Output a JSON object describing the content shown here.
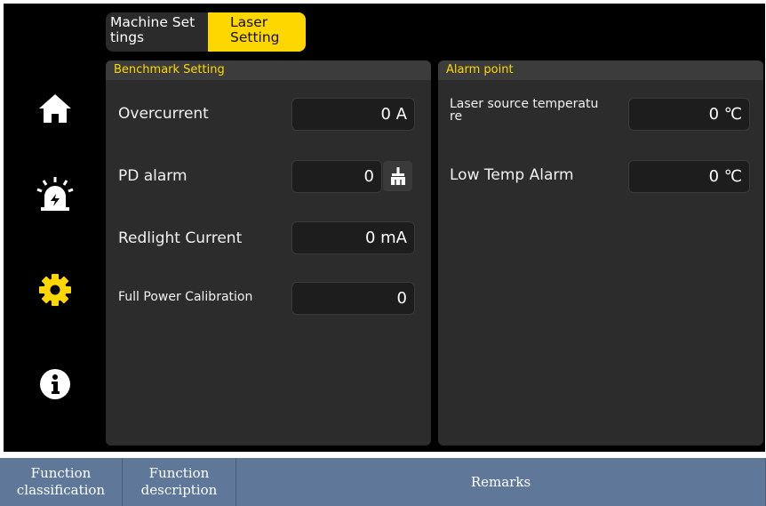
{
  "tabs": [
    {
      "label": "Machine Set\ntings",
      "active": false
    },
    {
      "label": "Laser\nSetting",
      "active": true
    }
  ],
  "sidebar": {
    "items": [
      {
        "icon": "home-icon"
      },
      {
        "icon": "alarm-icon"
      },
      {
        "icon": "gear-icon",
        "active": true
      },
      {
        "icon": "info-icon"
      }
    ]
  },
  "benchmark": {
    "title": "Benchmark Setting",
    "rows": [
      {
        "label": "Overcurrent",
        "value": "0 A"
      },
      {
        "label": "PD alarm",
        "value": "0"
      },
      {
        "label": "Redlight Current",
        "value": "0 mA"
      },
      {
        "label": "Full Power Calibration",
        "value": "0"
      }
    ]
  },
  "alarm": {
    "title": "Alarm point",
    "rows": [
      {
        "label": "Laser source temperatu\nre",
        "value": "0 ℃"
      },
      {
        "label": "Low Temp Alarm",
        "value": "0 ℃"
      }
    ]
  },
  "table_header": [
    "Function\nclassification",
    "Function\ndescription",
    "Remarks"
  ],
  "colors": {
    "accent": "#ffd700",
    "panel": "#2c2c2c",
    "table_header": "#5f7899"
  }
}
